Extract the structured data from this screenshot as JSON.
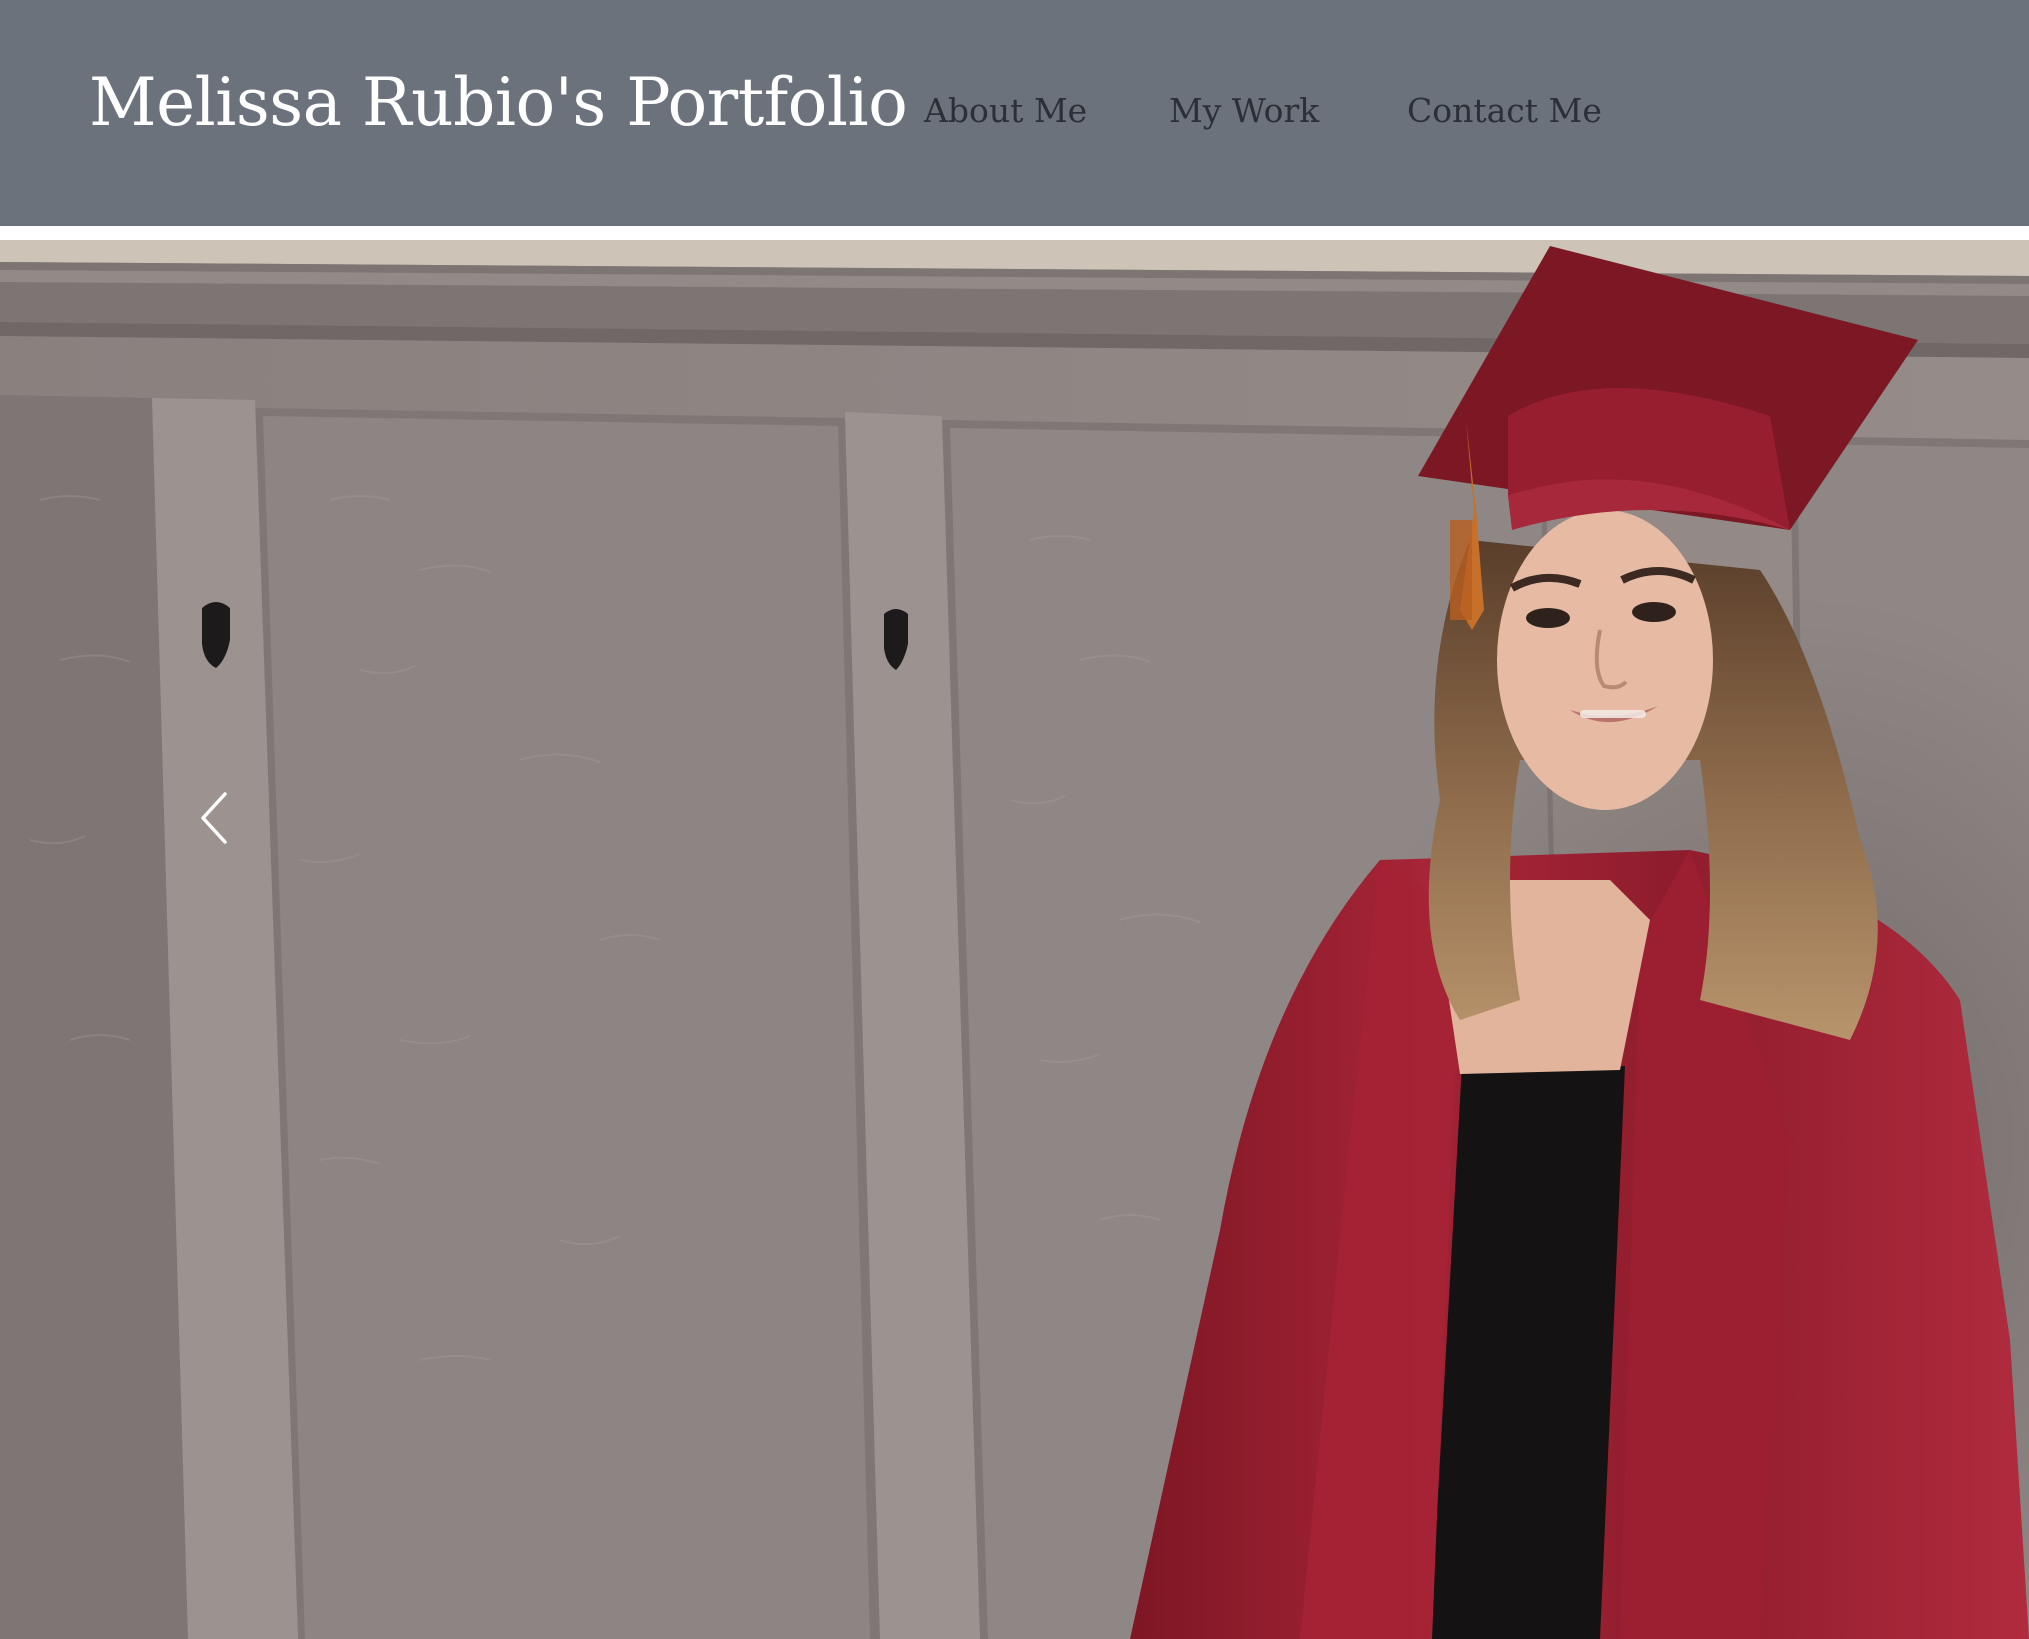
{
  "header": {
    "title": "Melissa Rubio's Portfolio",
    "nav": [
      {
        "label": "About Me"
      },
      {
        "label": "My Work"
      },
      {
        "label": "Contact Me"
      }
    ]
  },
  "slideshow": {
    "prev_icon": "chevron-left-icon"
  },
  "colors": {
    "header_bg": "#6b727c",
    "title": "#ffffff",
    "nav_text": "#2c3036",
    "gown": "#9a1f2e"
  }
}
